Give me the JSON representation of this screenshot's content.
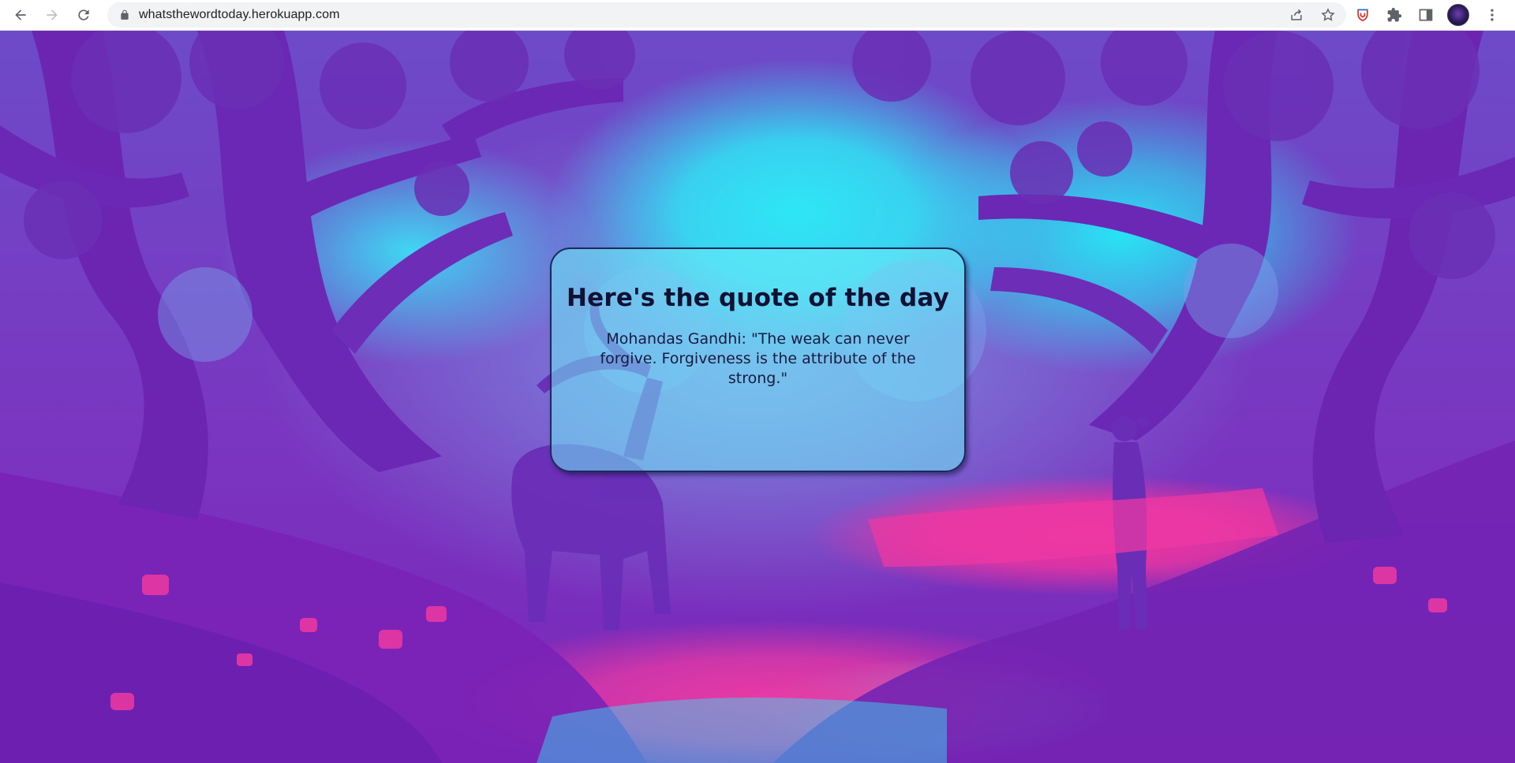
{
  "browser": {
    "url": "whatsthewordtoday.herokuapp.com",
    "icons": {
      "back": "back-arrow-icon",
      "forward": "forward-arrow-icon",
      "reload": "reload-icon",
      "lock": "lock-icon",
      "share": "share-icon",
      "bookmark": "star-icon",
      "extension_shield": "shield-extension-icon",
      "extensions": "puzzle-icon",
      "side_panel": "side-panel-icon",
      "profile": "avatar",
      "menu": "kebab-menu-icon"
    }
  },
  "page": {
    "title": "Here's the quote of the day",
    "quote": "Mohandas Gandhi: \"The weak can never forgive. Forgiveness is the attribute of the strong.\"",
    "colors": {
      "cyan": "#2ee6f6",
      "purple": "#7a26b8",
      "pink": "#ea3aa4",
      "card_border": "#1c2a5a"
    }
  }
}
